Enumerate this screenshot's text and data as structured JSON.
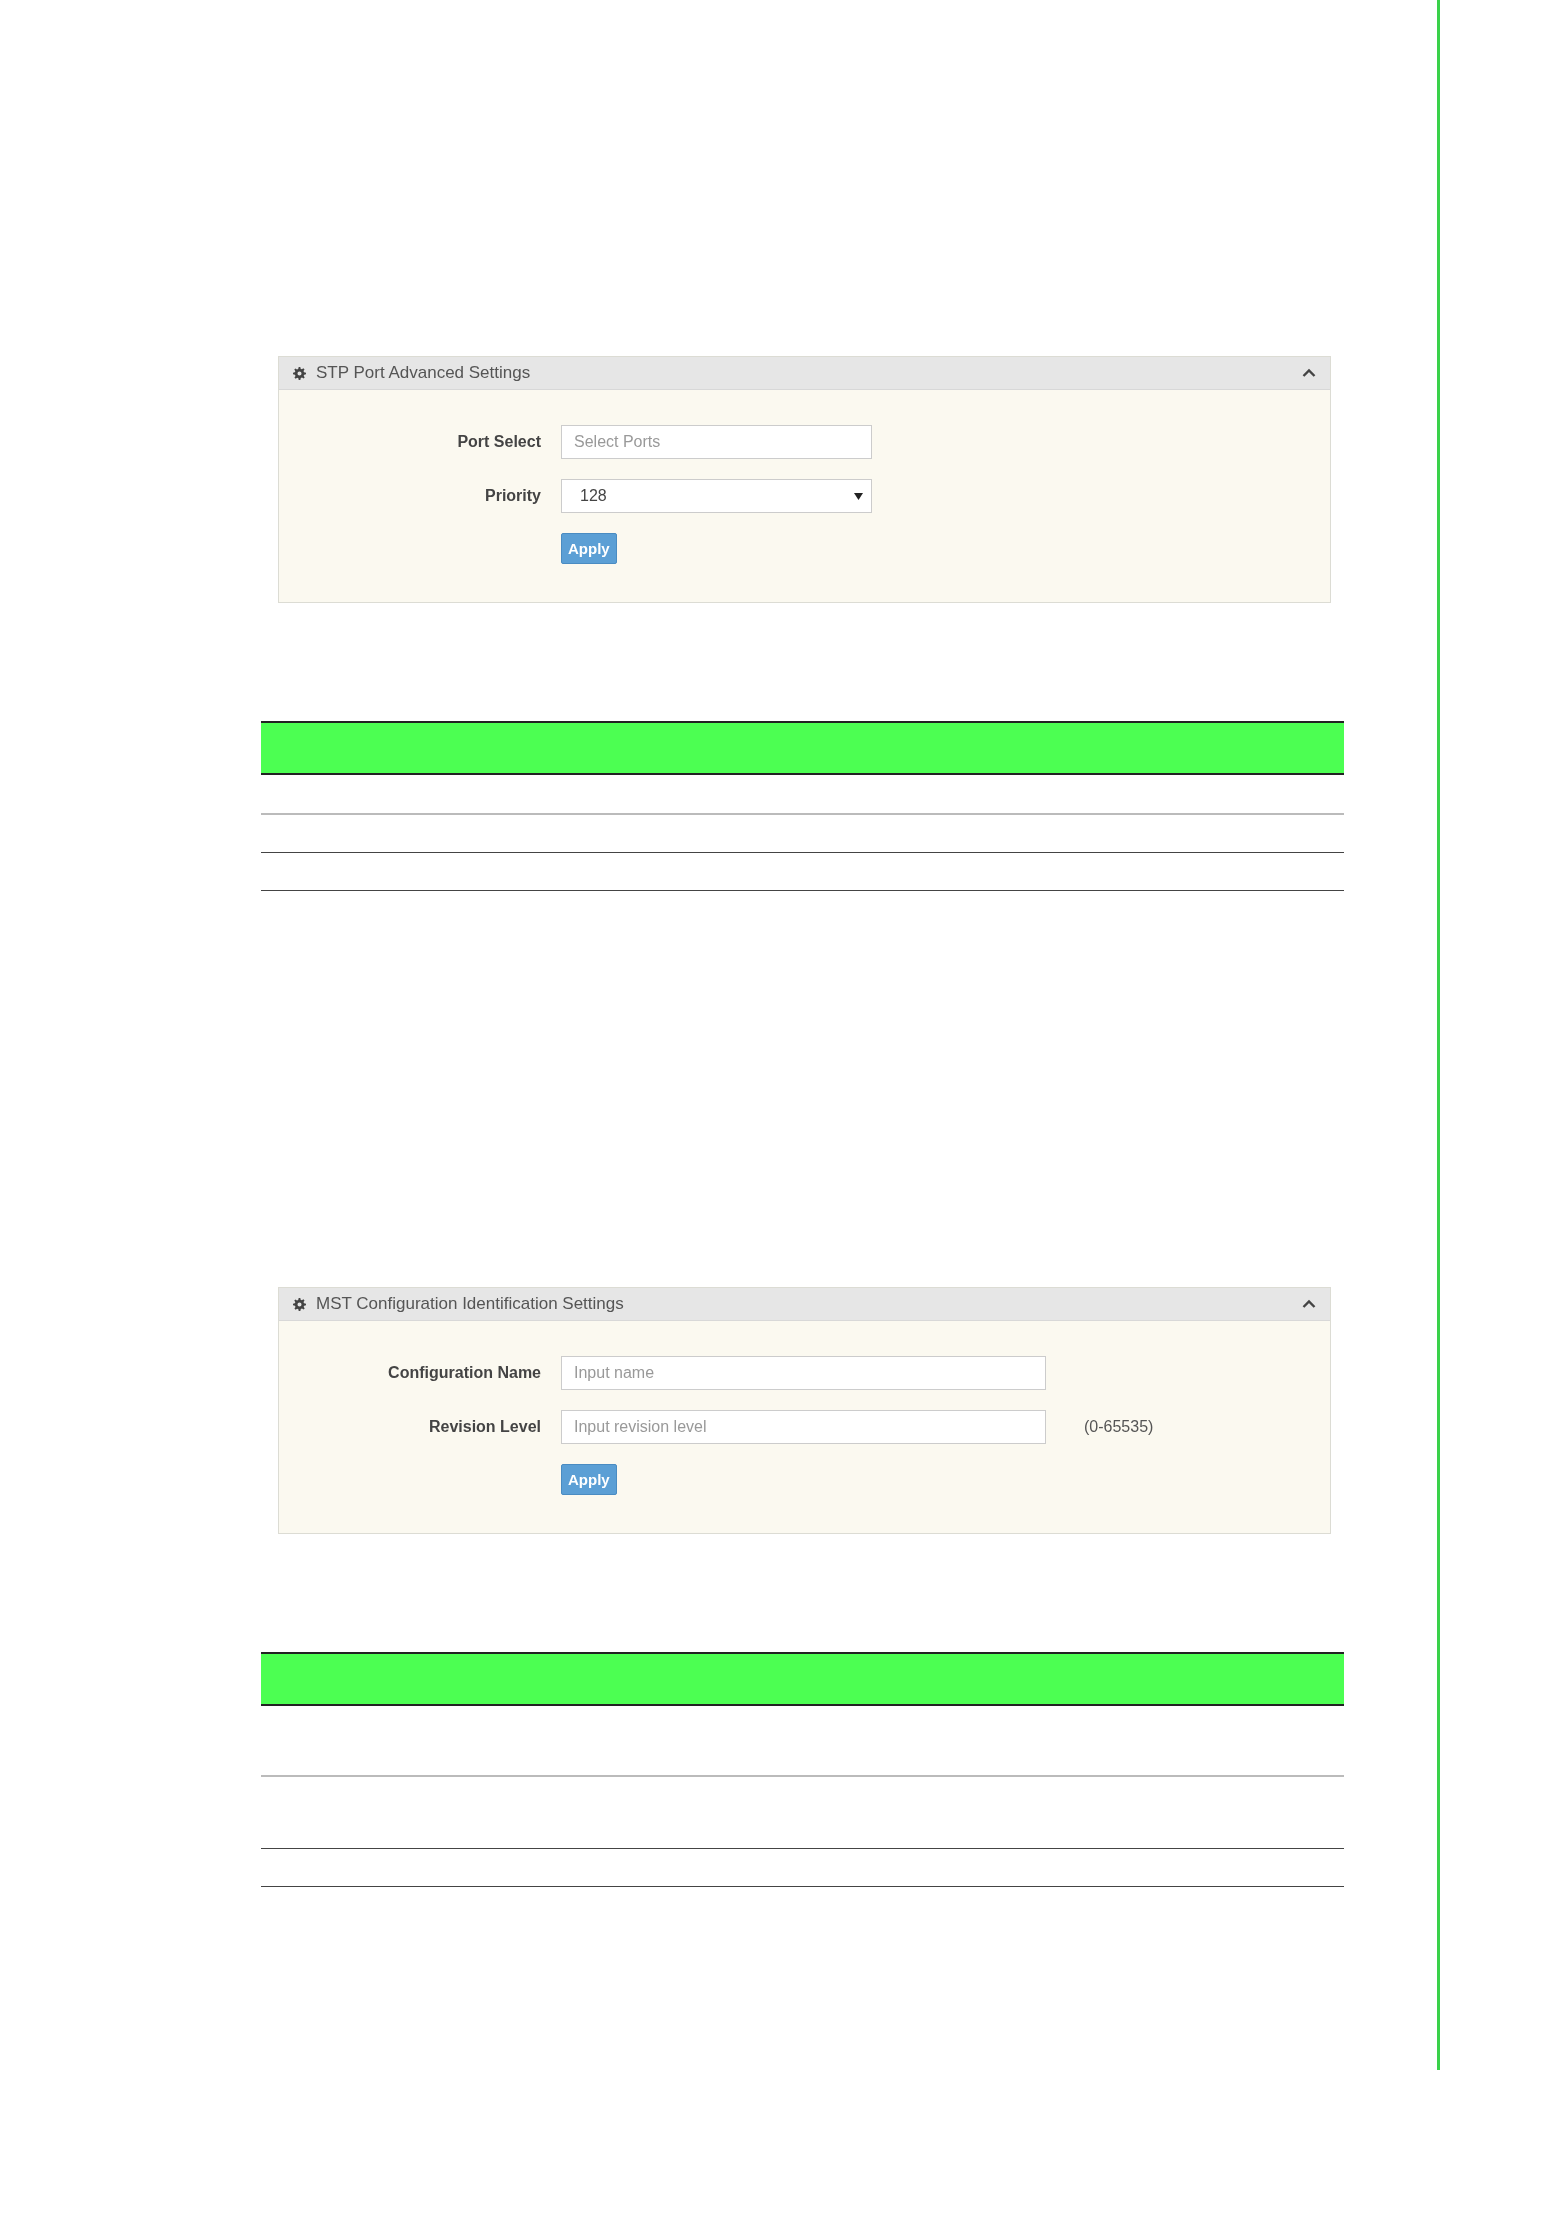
{
  "panels": [
    {
      "title": "STP Port Advanced Settings",
      "expanded": true,
      "button": "Apply",
      "fields": [
        {
          "kind": "text",
          "label": "Port Select",
          "placeholder": "Select Ports"
        },
        {
          "kind": "select",
          "label": "Priority",
          "value": "128"
        }
      ]
    },
    {
      "title": "MST Configuration Identification Settings",
      "expanded": true,
      "button": "Apply",
      "fields": [
        {
          "kind": "text",
          "label": "Configuration Name",
          "placeholder": "Input name"
        },
        {
          "kind": "text",
          "label": "Revision Level",
          "placeholder": "Input revision level",
          "hint": "(0-65535)"
        }
      ]
    }
  ]
}
